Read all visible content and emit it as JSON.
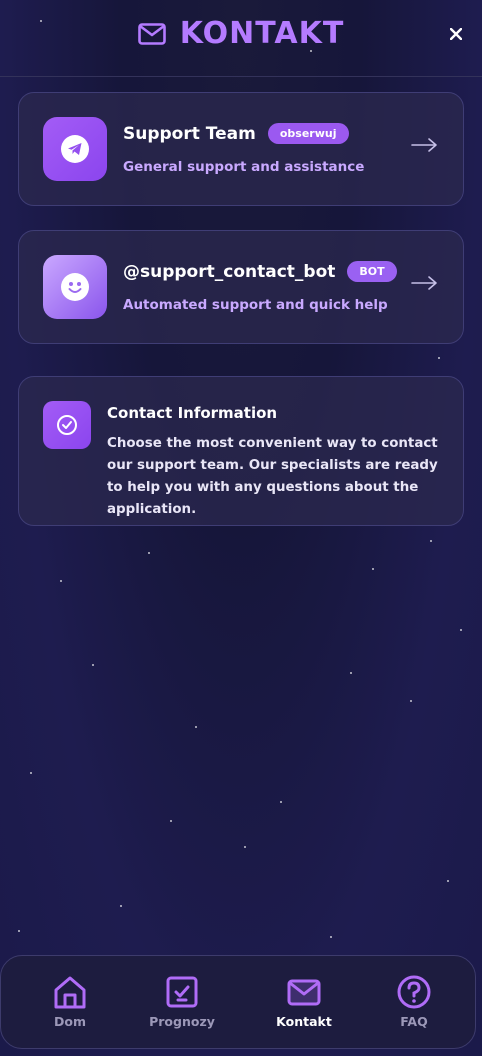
{
  "header": {
    "title": "KONTAKT",
    "icon": "envelope-icon",
    "close_icon": "close-icon"
  },
  "contacts": [
    {
      "title": "Support Team",
      "badge": "obserwuj",
      "subtitle": "General support and assistance",
      "icon": "telegram-icon",
      "arrow": "arrow-right-icon"
    },
    {
      "title": "@support_contact_bot",
      "badge": "BOT",
      "subtitle": "Automated support and quick help",
      "icon": "smiley-bot-icon",
      "arrow": "arrow-right-icon"
    }
  ],
  "info": {
    "title": "Contact Information",
    "text": "Choose the most convenient way to contact our support team. Our specialists are ready to help you with any questions about the application.",
    "icon": "check-circle-icon"
  },
  "nav": {
    "items": [
      {
        "label": "Dom",
        "icon": "home-icon",
        "active": false
      },
      {
        "label": "Prognozy",
        "icon": "check-square-icon",
        "active": false
      },
      {
        "label": "Kontakt",
        "icon": "envelope-icon",
        "active": true
      },
      {
        "label": "FAQ",
        "icon": "question-circle-icon",
        "active": false
      }
    ]
  },
  "colors": {
    "accent": "#a35cf6",
    "accent_light": "#c9a9ff",
    "background": "#1b1a4a",
    "card": "#2a284e"
  }
}
